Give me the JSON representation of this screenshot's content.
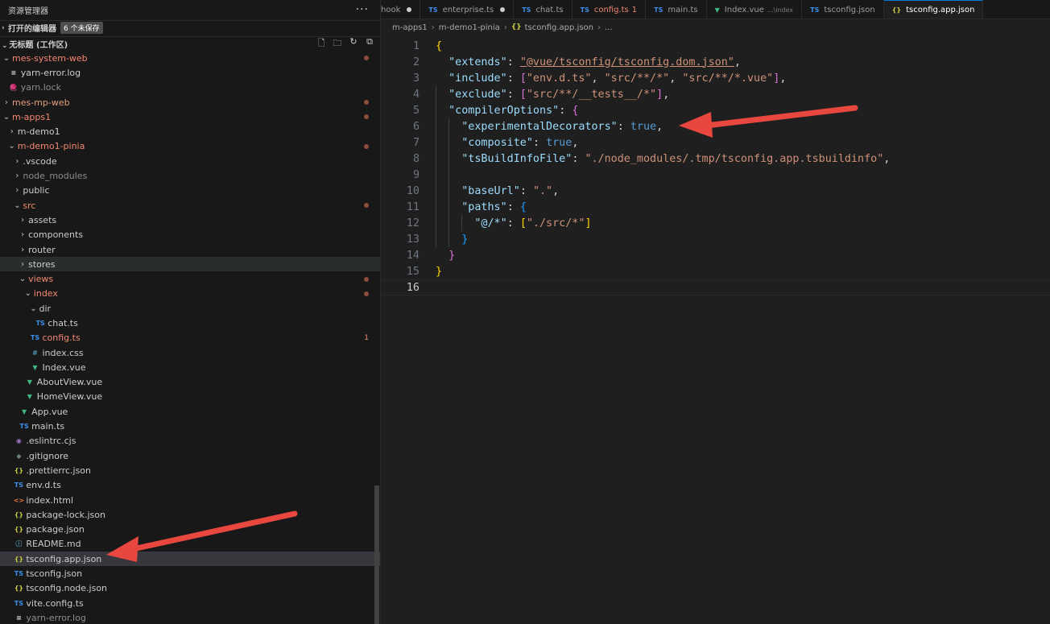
{
  "sidebar": {
    "title": "资源管理器",
    "more": "···",
    "open_editors": {
      "label": "打开的编辑器",
      "badge": "6 个未保存"
    },
    "workspace": {
      "label": "无标题 (工作区)"
    },
    "tree": [
      {
        "label": "mes-system-web",
        "depth": 0,
        "chev": "⌄",
        "cls": "err",
        "dot": true
      },
      {
        "label": "yarn-error.log",
        "depth": 1,
        "icon": "≡",
        "ico": "",
        "cls": ""
      },
      {
        "label": "yarn.lock",
        "depth": 1,
        "icon": "🧶",
        "ico": "yarn",
        "cls": "dim"
      },
      {
        "label": "mes-mp-web",
        "depth": 0,
        "chev": "›",
        "cls": "mod",
        "dot": true
      },
      {
        "label": "m-apps1",
        "depth": 0,
        "chev": "⌄",
        "cls": "err",
        "dot": true
      },
      {
        "label": "m-demo1",
        "depth": 1,
        "chev": "›",
        "cls": ""
      },
      {
        "label": "m-demo1-pinia",
        "depth": 1,
        "chev": "⌄",
        "cls": "err",
        "dot": true
      },
      {
        "label": ".vscode",
        "depth": 2,
        "chev": "›",
        "cls": ""
      },
      {
        "label": "node_modules",
        "depth": 2,
        "chev": "›",
        "cls": "dim"
      },
      {
        "label": "public",
        "depth": 2,
        "chev": "›",
        "cls": ""
      },
      {
        "label": "src",
        "depth": 2,
        "chev": "⌄",
        "cls": "err",
        "dot": true
      },
      {
        "label": "assets",
        "depth": 3,
        "chev": "›",
        "cls": ""
      },
      {
        "label": "components",
        "depth": 3,
        "chev": "›",
        "cls": ""
      },
      {
        "label": "router",
        "depth": 3,
        "chev": "›",
        "cls": ""
      },
      {
        "label": "stores",
        "depth": 3,
        "chev": "›",
        "cls": "",
        "hover": true
      },
      {
        "label": "views",
        "depth": 3,
        "chev": "⌄",
        "cls": "err",
        "dot": true
      },
      {
        "label": "index",
        "depth": 4,
        "chev": "⌄",
        "cls": "err",
        "dot": true
      },
      {
        "label": "dir",
        "depth": 5,
        "chev": "⌄",
        "cls": ""
      },
      {
        "label": "chat.ts",
        "depth": 6,
        "icon": "TS",
        "ico": "ts",
        "cls": ""
      },
      {
        "label": "config.ts",
        "depth": 5,
        "icon": "TS",
        "ico": "ts",
        "cls": "err",
        "count": "1"
      },
      {
        "label": "index.css",
        "depth": 5,
        "icon": "#",
        "ico": "css",
        "cls": ""
      },
      {
        "label": "Index.vue",
        "depth": 5,
        "icon": "▼",
        "ico": "vue",
        "cls": ""
      },
      {
        "label": "AboutView.vue",
        "depth": 4,
        "icon": "▼",
        "ico": "vue",
        "cls": ""
      },
      {
        "label": "HomeView.vue",
        "depth": 4,
        "icon": "▼",
        "ico": "vue",
        "cls": ""
      },
      {
        "label": "App.vue",
        "depth": 3,
        "icon": "▼",
        "ico": "vue",
        "cls": ""
      },
      {
        "label": "main.ts",
        "depth": 3,
        "icon": "TS",
        "ico": "ts",
        "cls": ""
      },
      {
        "label": ".eslintrc.cjs",
        "depth": 2,
        "icon": "◉",
        "ico": "eslint",
        "cls": ""
      },
      {
        "label": ".gitignore",
        "depth": 2,
        "icon": "◆",
        "ico": "git",
        "cls": ""
      },
      {
        "label": ".prettierrc.json",
        "depth": 2,
        "icon": "{}",
        "ico": "json",
        "cls": ""
      },
      {
        "label": "env.d.ts",
        "depth": 2,
        "icon": "TS",
        "ico": "ts",
        "cls": ""
      },
      {
        "label": "index.html",
        "depth": 2,
        "icon": "<>",
        "ico": "html",
        "cls": ""
      },
      {
        "label": "package-lock.json",
        "depth": 2,
        "icon": "{}",
        "ico": "json",
        "cls": ""
      },
      {
        "label": "package.json",
        "depth": 2,
        "icon": "{}",
        "ico": "json",
        "cls": ""
      },
      {
        "label": "README.md",
        "depth": 2,
        "icon": "ⓘ",
        "ico": "info",
        "cls": ""
      },
      {
        "label": "tsconfig.app.json",
        "depth": 2,
        "icon": "{}",
        "ico": "json",
        "cls": "",
        "selected": true
      },
      {
        "label": "tsconfig.json",
        "depth": 2,
        "icon": "TS",
        "ico": "tsjson",
        "cls": ""
      },
      {
        "label": "tsconfig.node.json",
        "depth": 2,
        "icon": "{}",
        "ico": "json",
        "cls": ""
      },
      {
        "label": "vite.config.ts",
        "depth": 2,
        "icon": "TS",
        "ico": "ts",
        "cls": ""
      },
      {
        "label": "yarn-error.log",
        "depth": 2,
        "icon": "≡",
        "ico": "",
        "cls": "dim"
      }
    ]
  },
  "tabs": [
    {
      "label": "hook",
      "icon": "",
      "ico": "",
      "dirty": true
    },
    {
      "label": "enterprise.ts",
      "icon": "TS",
      "ico": "ts",
      "dirty": true
    },
    {
      "label": "chat.ts",
      "icon": "TS",
      "ico": "ts"
    },
    {
      "label": "config.ts",
      "icon": "TS",
      "ico": "ts",
      "err": "1",
      "errlabel": true
    },
    {
      "label": "main.ts",
      "icon": "TS",
      "ico": "ts"
    },
    {
      "label": "Index.vue",
      "icon": "▼",
      "ico": "vue",
      "sub": "...\\index"
    },
    {
      "label": "tsconfig.json",
      "icon": "TS",
      "ico": "tsjson"
    },
    {
      "label": "tsconfig.app.json",
      "icon": "{}",
      "ico": "json",
      "active": true
    }
  ],
  "breadcrumbs": [
    "m-apps1",
    "m-demo1-pinia",
    "tsconfig.app.json",
    "..."
  ],
  "breadcrumb_icon": "{}",
  "code": {
    "current_line": 16,
    "lines": [
      [
        [
          "{",
          "p1"
        ]
      ],
      [
        [
          "  ",
          ""
        ],
        [
          "\"extends\"",
          "k"
        ],
        [
          ": ",
          ""
        ],
        [
          "\"@vue/tsconfig/tsconfig.dom.json\"",
          "s u"
        ],
        [
          ",",
          ""
        ]
      ],
      [
        [
          "  ",
          ""
        ],
        [
          "\"include\"",
          "k"
        ],
        [
          ": ",
          ""
        ],
        [
          "[",
          "p2"
        ],
        [
          "\"env.d.ts\"",
          "s"
        ],
        [
          ", ",
          ""
        ],
        [
          "\"src/**/*\"",
          "s"
        ],
        [
          ", ",
          ""
        ],
        [
          "\"src/**/*.vue\"",
          "s"
        ],
        [
          "]",
          "p2"
        ],
        [
          ",",
          ""
        ]
      ],
      [
        [
          "  ",
          ""
        ],
        [
          "\"exclude\"",
          "k"
        ],
        [
          ": ",
          ""
        ],
        [
          "[",
          "p2"
        ],
        [
          "\"src/**/__tests__/*\"",
          "s"
        ],
        [
          "]",
          "p2"
        ],
        [
          ",",
          ""
        ]
      ],
      [
        [
          "  ",
          ""
        ],
        [
          "\"compilerOptions\"",
          "k"
        ],
        [
          ": ",
          ""
        ],
        [
          "{",
          "p2"
        ]
      ],
      [
        [
          "    ",
          ""
        ],
        [
          "\"experimentalDecorators\"",
          "k"
        ],
        [
          ": ",
          ""
        ],
        [
          "true",
          "b"
        ],
        [
          ",",
          ""
        ]
      ],
      [
        [
          "    ",
          ""
        ],
        [
          "\"composite\"",
          "k"
        ],
        [
          ": ",
          ""
        ],
        [
          "true",
          "b"
        ],
        [
          ",",
          ""
        ]
      ],
      [
        [
          "    ",
          ""
        ],
        [
          "\"tsBuildInfoFile\"",
          "k"
        ],
        [
          ": ",
          ""
        ],
        [
          "\"./node_modules/.tmp/tsconfig.app.tsbuildinfo\"",
          "s"
        ],
        [
          ",",
          ""
        ]
      ],
      [
        [
          "",
          ""
        ]
      ],
      [
        [
          "    ",
          ""
        ],
        [
          "\"baseUrl\"",
          "k"
        ],
        [
          ": ",
          ""
        ],
        [
          "\".\"",
          "s"
        ],
        [
          ",",
          ""
        ]
      ],
      [
        [
          "    ",
          ""
        ],
        [
          "\"paths\"",
          "k"
        ],
        [
          ": ",
          ""
        ],
        [
          "{",
          "p3"
        ]
      ],
      [
        [
          "      ",
          ""
        ],
        [
          "\"@/*\"",
          "k"
        ],
        [
          ": ",
          ""
        ],
        [
          "[",
          "p1"
        ],
        [
          "\"./src/*\"",
          "s"
        ],
        [
          "]",
          "p1"
        ]
      ],
      [
        [
          "    ",
          ""
        ],
        [
          "}",
          "p3"
        ]
      ],
      [
        [
          "  ",
          ""
        ],
        [
          "}",
          "p2"
        ]
      ],
      [
        [
          "}",
          "p1"
        ]
      ],
      [
        [
          "",
          ""
        ]
      ]
    ]
  },
  "colors": {
    "arrow": "#e8473f",
    "accent": "#0078d4"
  }
}
